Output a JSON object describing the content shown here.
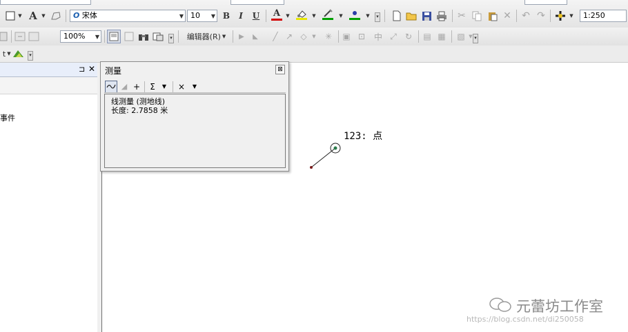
{
  "toolbar1": {
    "font_name": "宋体",
    "font_size": "10",
    "bold_label": "B",
    "italic_label": "I",
    "underline_label": "U",
    "font_color_label": "A",
    "scale": "1:250",
    "colors": {
      "font_color_bar": "#d10000",
      "fill_color_bar": "#e8e800",
      "line_color_bar": "#00a000"
    }
  },
  "toolbar2": {
    "zoom": "100%",
    "editor_label": "编辑器(R)"
  },
  "toolbar3": {
    "label": "t"
  },
  "left_panel": {
    "pin_icon": "⊐",
    "close_icon": "✕",
    "item_text": "事件"
  },
  "measure_dialog": {
    "title": "测量",
    "sum_label": "Σ",
    "clear_label": "×",
    "result_line1": "线测量 (测地线)",
    "result_line2": "长度: 2.7858 米"
  },
  "map": {
    "point_label": "123: 点"
  },
  "watermark": {
    "brand": "元蕾坊工作室",
    "url": "https://blog.csdn.net/di250058"
  }
}
